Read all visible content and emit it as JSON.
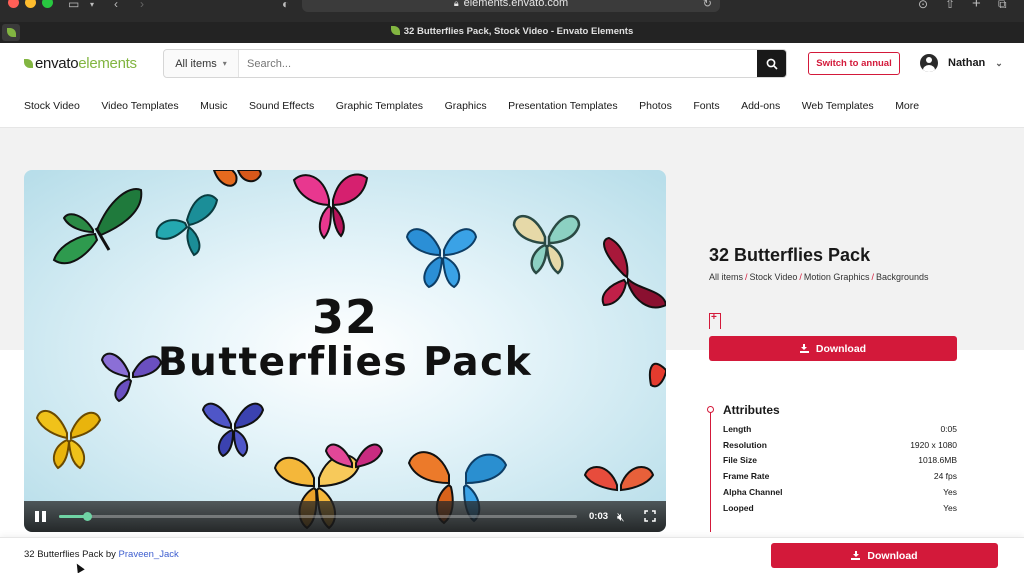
{
  "browser": {
    "url": "elements.envato.com",
    "tab_title": "32 Butterflies Pack, Stock Video - Envato Elements"
  },
  "header": {
    "logo_text": "envato",
    "logo_text_light": "elements",
    "search": {
      "filter_label": "All items",
      "placeholder": "Search..."
    },
    "switch_label": "Switch to annual",
    "user_name": "Nathan"
  },
  "nav": [
    "Stock Video",
    "Video Templates",
    "Music",
    "Sound Effects",
    "Graphic Templates",
    "Graphics",
    "Presentation Templates",
    "Photos",
    "Fonts",
    "Add-ons",
    "Web Templates",
    "More"
  ],
  "video": {
    "overlay_line1": "32",
    "overlay_line2": "Butterflies Pack",
    "time": "0:03",
    "progress": 0.055
  },
  "item": {
    "title": "32 Butterflies Pack",
    "breadcrumbs": [
      "All items",
      "Stock Video",
      "Motion Graphics",
      "Backgrounds"
    ],
    "download_label": "Download"
  },
  "attributes": {
    "title": "Attributes",
    "rows": [
      {
        "key": "Length",
        "value": "0:05"
      },
      {
        "key": "Resolution",
        "value": "1920 x 1080"
      },
      {
        "key": "File Size",
        "value": "1018.6MB"
      },
      {
        "key": "Frame Rate",
        "value": "24 fps"
      },
      {
        "key": "Alpha Channel",
        "value": "Yes"
      },
      {
        "key": "Looped",
        "value": "Yes"
      }
    ]
  },
  "footer": {
    "item_name": "32 Butterflies Pack",
    "by_word": "by",
    "author": "Praveen_Jack",
    "download_label": "Download"
  },
  "colors": {
    "accent": "#d3193a",
    "brand_green": "#82b541",
    "progress": "#6fd3a4"
  }
}
